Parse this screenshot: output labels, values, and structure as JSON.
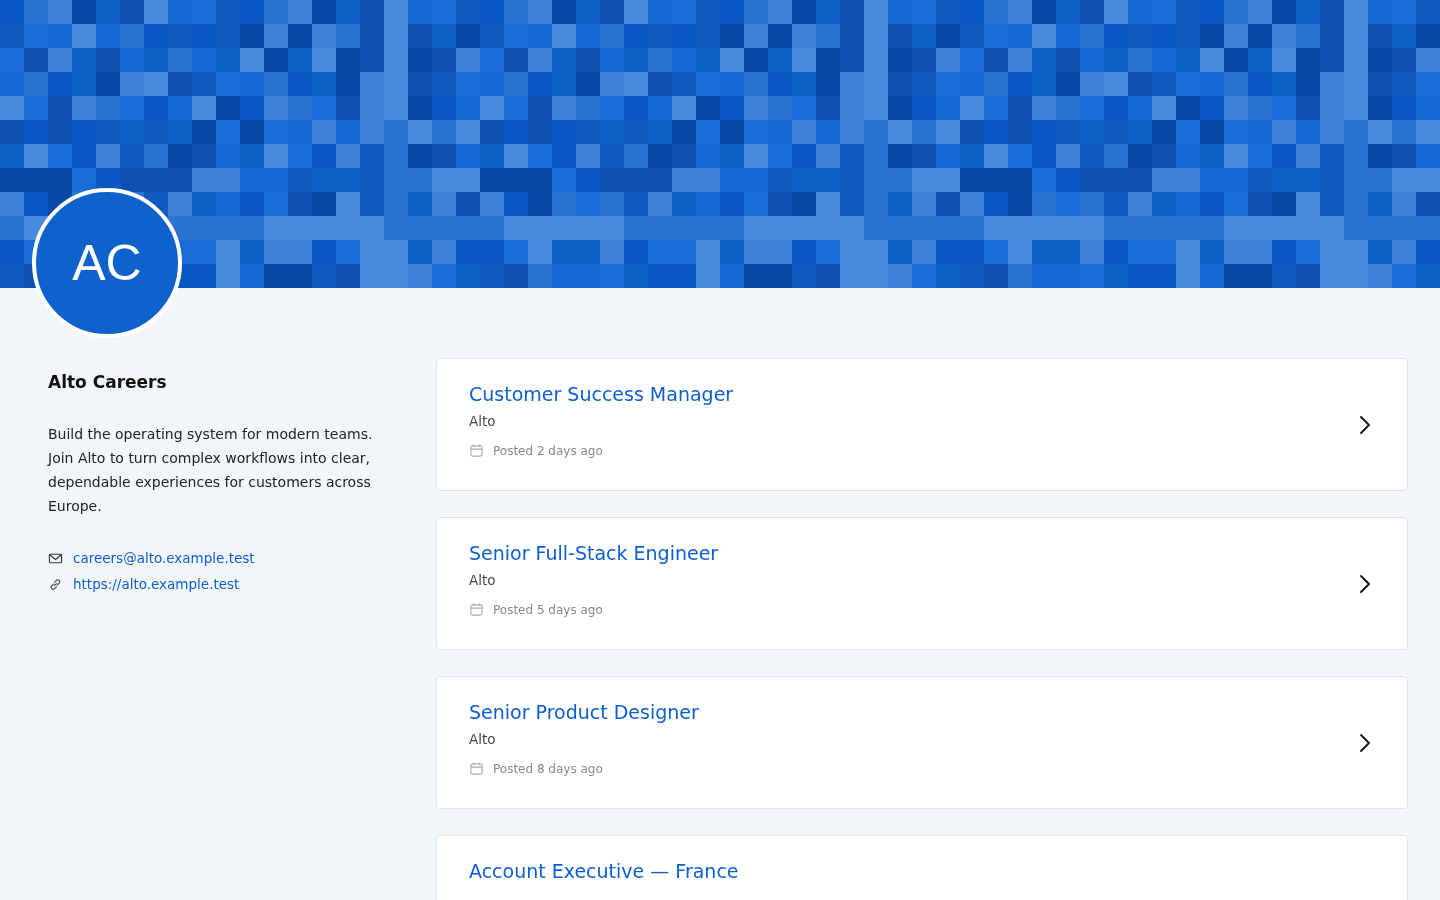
{
  "profile": {
    "initials": "AC",
    "name": "Alto Careers",
    "description": "Build the operating system for modern teams. Join Alto to turn complex workflows into clear, dependable experiences for customers across Europe.",
    "email": "careers@alto.example.test",
    "website": "https://alto.example.test"
  },
  "jobs": [
    {
      "title": "Customer Success Manager",
      "company": "Alto",
      "posted": "Posted 2 days ago"
    },
    {
      "title": "Senior Full-Stack Engineer",
      "company": "Alto",
      "posted": "Posted 5 days ago"
    },
    {
      "title": "Senior Product Designer",
      "company": "Alto",
      "posted": "Posted 8 days ago"
    },
    {
      "title": "Account Executive — France"
    }
  ]
}
